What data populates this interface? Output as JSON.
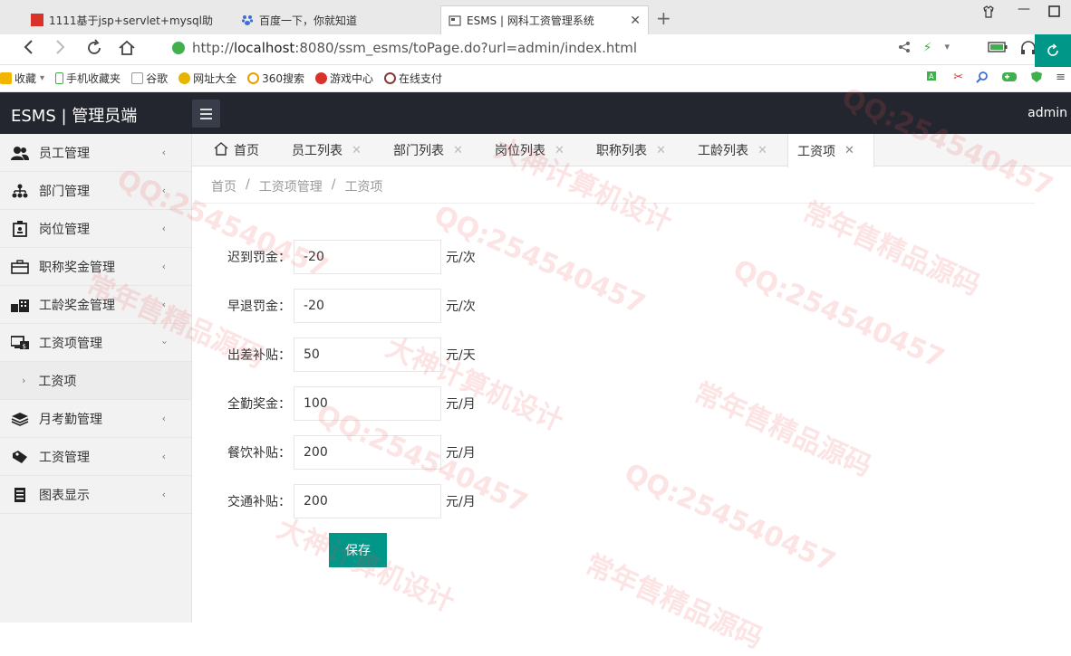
{
  "browser": {
    "tabs": [
      {
        "title": "1111基于jsp+servlet+mysql助",
        "active": false
      },
      {
        "title": "百度一下，你就知道",
        "active": false
      },
      {
        "title": "ESMS | 网科工资管理系统",
        "active": true
      }
    ],
    "url_prefix": "http://",
    "url_host": "localhost",
    "url_rest": ":8080/ssm_esms/toPage.do?url=admin/index.html",
    "bookmarks": [
      "收藏",
      "手机收藏夹",
      "谷歌",
      "网址大全",
      "360搜索",
      "游戏中心",
      "在线支付"
    ]
  },
  "header": {
    "logo": "ESMS | 管理员端",
    "user": "admin"
  },
  "sidebar": {
    "items": [
      {
        "label": "员工管理",
        "icon": "users-icon",
        "expanded": false
      },
      {
        "label": "部门管理",
        "icon": "org-chart-icon",
        "expanded": false
      },
      {
        "label": "岗位管理",
        "icon": "badge-icon",
        "expanded": false
      },
      {
        "label": "职称奖金管理",
        "icon": "briefcase-icon",
        "expanded": false
      },
      {
        "label": "工龄奖金管理",
        "icon": "building-icon",
        "expanded": false
      },
      {
        "label": "工资项管理",
        "icon": "monitor-money-icon",
        "expanded": true
      },
      {
        "label": "月考勤管理",
        "icon": "layers-icon",
        "expanded": false
      },
      {
        "label": "工资管理",
        "icon": "tag-icon",
        "expanded": false
      },
      {
        "label": "图表显示",
        "icon": "book-icon",
        "expanded": false
      }
    ],
    "subitem": "工资项"
  },
  "page_tabs": [
    {
      "label": "首页",
      "closable": false
    },
    {
      "label": "员工列表",
      "closable": true
    },
    {
      "label": "部门列表",
      "closable": true
    },
    {
      "label": "岗位列表",
      "closable": true
    },
    {
      "label": "职称列表",
      "closable": true
    },
    {
      "label": "工龄列表",
      "closable": true
    },
    {
      "label": "工资项",
      "closable": true,
      "active": true
    }
  ],
  "breadcrumb": [
    "首页",
    "工资项管理",
    "工资项"
  ],
  "form": {
    "fields": [
      {
        "label": "迟到罚金：",
        "value": "-20",
        "unit": "元/次"
      },
      {
        "label": "早退罚金：",
        "value": "-20",
        "unit": "元/次"
      },
      {
        "label": "出差补贴：",
        "value": "50",
        "unit": "元/天"
      },
      {
        "label": "全勤奖金：",
        "value": "100",
        "unit": "元/月"
      },
      {
        "label": "餐饮补贴：",
        "value": "200",
        "unit": "元/月"
      },
      {
        "label": "交通补贴：",
        "value": "200",
        "unit": "元/月"
      }
    ],
    "save_label": "保存"
  },
  "watermark": {
    "lines": [
      "QQ:254540457",
      "常年售精品源码",
      "大神计算机设计"
    ]
  },
  "colors": {
    "accent": "#009688",
    "header_bg": "#23262e"
  }
}
